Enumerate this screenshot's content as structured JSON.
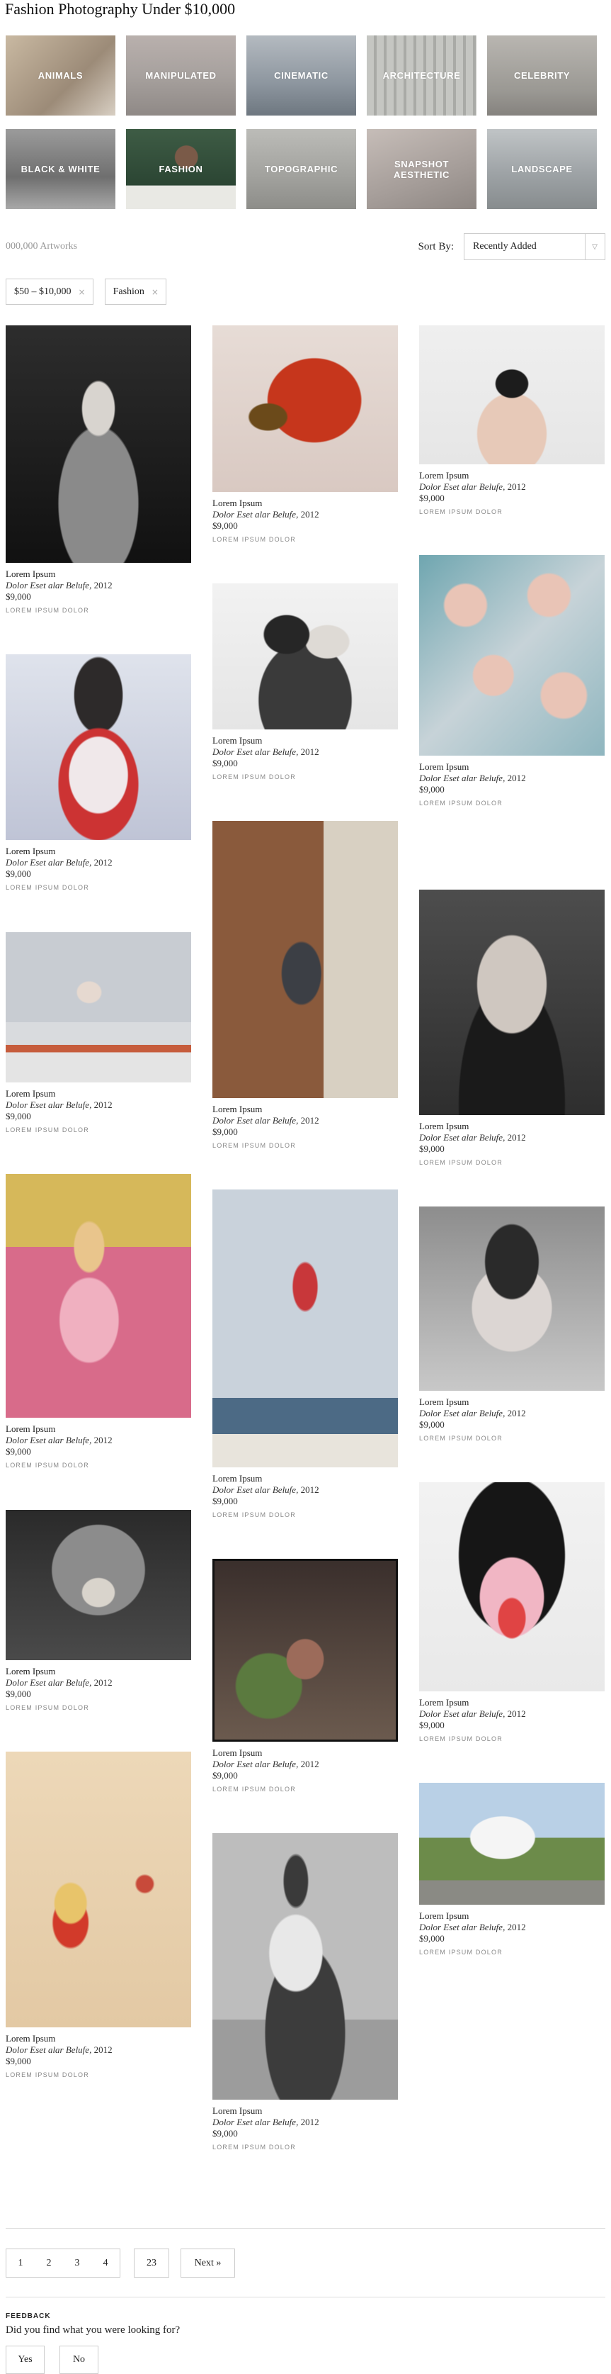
{
  "page": {
    "title": "Fashion Photography Under $10,000"
  },
  "categories": [
    {
      "label": "Animals",
      "color": "#b8a794"
    },
    {
      "label": "Manipulated",
      "color": "#a9a09e"
    },
    {
      "label": "Cinematic",
      "color": "#9aa4ad"
    },
    {
      "label": "Architecture",
      "color": "#b4b5b1"
    },
    {
      "label": "Celebrity",
      "color": "#a8a6a2"
    },
    {
      "label": "Black & White",
      "color": "#8c8c8c"
    },
    {
      "label": "Fashion",
      "color": "#324c3b"
    },
    {
      "label": "Topographic",
      "color": "#a7a7a3"
    },
    {
      "label": "Snapshot Aesthetic",
      "color": "#b2aba7"
    },
    {
      "label": "Landscape",
      "color": "#a8acae"
    }
  ],
  "toolbar": {
    "count": "000,000 Artworks",
    "sort_label": "Sort By:",
    "sort_value": "Recently Added",
    "sort_arrow": "▽"
  },
  "filters": [
    {
      "label": "$50 – $10,000",
      "remove": "×"
    },
    {
      "label": "Fashion",
      "remove": "×"
    }
  ],
  "artworks": {
    "name": "Lorem Ipsum",
    "title": "Dolor Eset alar Belufe,",
    "year": "2012",
    "price": "$9,000",
    "gallery": "Lorem Ipsum Dolor"
  },
  "image_colors": {
    "c1": [
      "#2f2f2f",
      "#1a1a1a",
      "#9aa0a6",
      "#c9c9c9",
      "#e9e6e0"
    ],
    "c2": [
      "#bfb4c9",
      "#e0e4ea",
      "#b78ea0",
      "#a7a8a9",
      "#c8a267",
      "#d76c86",
      "#f2dec3"
    ],
    "c3": [
      "#e6e1e0",
      "#3b2d2b",
      "#8c8c8c",
      "#6f6060",
      "#dccabd",
      "#4e4e4e",
      "#eeeeee"
    ]
  },
  "pagination": {
    "pages": [
      "1",
      "2",
      "3",
      "4"
    ],
    "last": "23",
    "next": "Next »"
  },
  "feedback": {
    "heading": "FEEDBACK",
    "question": "Did you find what you were looking for?",
    "yes": "Yes",
    "no": "No"
  }
}
